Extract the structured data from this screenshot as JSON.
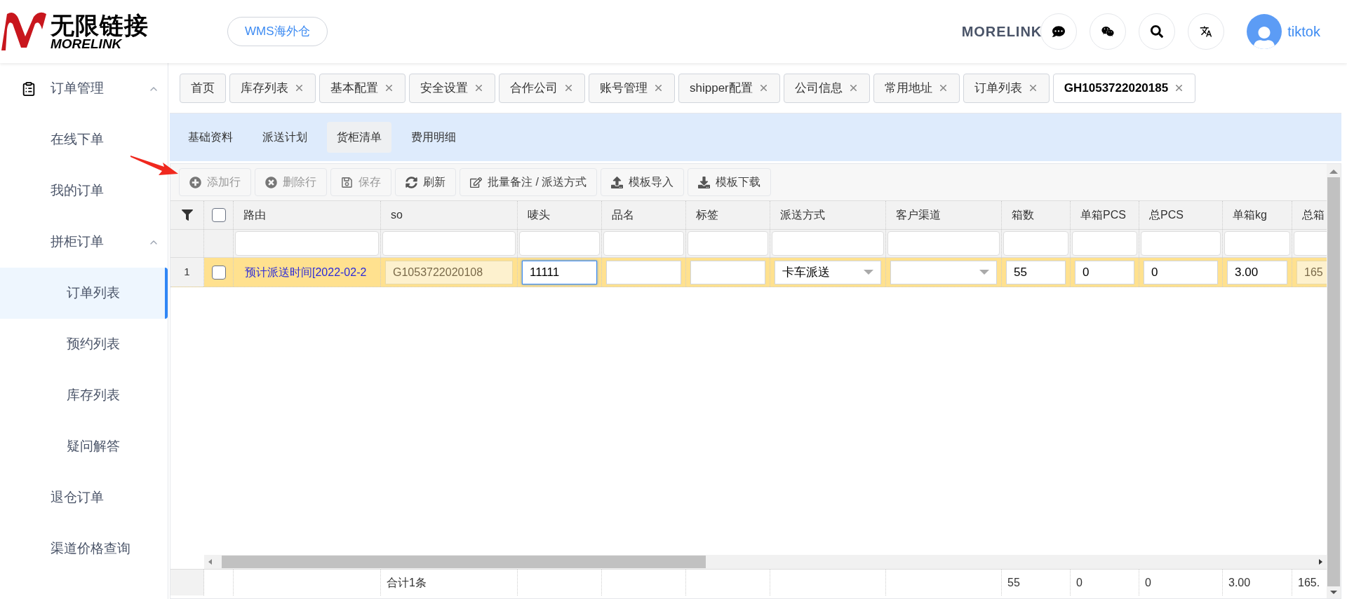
{
  "header": {
    "logo_title": "无限链接",
    "logo_subtitle": "MORELINK",
    "warehouse_button": "WMS海外仓",
    "brand": "MORELINK",
    "user": "tiktok"
  },
  "sidebar": {
    "items": [
      {
        "label": "订单管理",
        "expanded": true,
        "children": [
          {
            "label": "在线下单",
            "selected": false
          },
          {
            "label": "我的订单",
            "selected": false
          },
          {
            "label": "拼柜订单",
            "expanded": true,
            "selected": false,
            "children": [
              {
                "label": "订单列表",
                "selected": true
              },
              {
                "label": "预约列表",
                "selected": false
              },
              {
                "label": "库存列表",
                "selected": false
              },
              {
                "label": "疑问解答",
                "selected": false
              }
            ]
          },
          {
            "label": "退仓订单",
            "selected": false
          },
          {
            "label": "渠道价格查询",
            "selected": false
          }
        ]
      }
    ]
  },
  "tabs": [
    {
      "label": "首页",
      "selected": false,
      "closable": false
    },
    {
      "label": "库存列表",
      "selected": false,
      "closable": true
    },
    {
      "label": "基本配置",
      "selected": false,
      "closable": true
    },
    {
      "label": "安全设置",
      "selected": false,
      "closable": true
    },
    {
      "label": "合作公司",
      "selected": false,
      "closable": true
    },
    {
      "label": "账号管理",
      "selected": false,
      "closable": true
    },
    {
      "label": "shipper配置",
      "selected": false,
      "closable": true
    },
    {
      "label": "公司信息",
      "selected": false,
      "closable": true
    },
    {
      "label": "常用地址",
      "selected": false,
      "closable": true
    },
    {
      "label": "订单列表",
      "selected": false,
      "closable": true
    },
    {
      "label": "GH1053722020185",
      "selected": true,
      "closable": true
    }
  ],
  "subtabs": [
    {
      "label": "基础资料",
      "selected": false
    },
    {
      "label": "派送计划",
      "selected": false
    },
    {
      "label": "货柜清单",
      "selected": true
    },
    {
      "label": "费用明细",
      "selected": false
    }
  ],
  "toolbar": [
    {
      "label": "添加行",
      "disabled": true
    },
    {
      "label": "删除行",
      "disabled": true
    },
    {
      "label": "保存",
      "disabled": true
    },
    {
      "label": "刷新",
      "disabled": false
    },
    {
      "label": "批量备注 / 派送方式",
      "disabled": false
    },
    {
      "label": "模板导入",
      "disabled": false
    },
    {
      "label": "模板下载",
      "disabled": false
    }
  ],
  "table": {
    "all_checked": false,
    "columns": [
      {
        "label": "路由"
      },
      {
        "label": "so"
      },
      {
        "label": "唛头"
      },
      {
        "label": "品名"
      },
      {
        "label": "标签"
      },
      {
        "label": "派送方式"
      },
      {
        "label": "客户渠道"
      },
      {
        "label": "箱数"
      },
      {
        "label": "单箱PCS"
      },
      {
        "label": "总PCS"
      },
      {
        "label": "单箱kg"
      },
      {
        "label": "总箱"
      }
    ],
    "rows": [
      {
        "number": "1",
        "checked": false,
        "selected": true,
        "cells": [
          {
            "kind": "link",
            "value": "预计派送时间[2022-02-2"
          },
          {
            "kind": "readonly",
            "value": "G1053722020108"
          },
          {
            "kind": "input",
            "value": "11111",
            "focused": true
          },
          {
            "kind": "input",
            "focused": false
          },
          {
            "kind": "input",
            "focused": false
          },
          {
            "kind": "select",
            "value": "卡车派送"
          },
          {
            "kind": "select"
          },
          {
            "kind": "input",
            "value": "55",
            "focused": false
          },
          {
            "kind": "input",
            "value": "0",
            "focused": false
          },
          {
            "kind": "input",
            "value": "0",
            "focused": false
          },
          {
            "kind": "input",
            "value": "3.00",
            "focused": false
          },
          {
            "kind": "readonly",
            "value": "165"
          }
        ]
      }
    ],
    "footer": {
      "cells": [
        {},
        {
          "value": "合计1条"
        },
        {},
        {},
        {},
        {},
        {},
        {
          "value": "55"
        },
        {
          "value": "0"
        },
        {
          "value": "0"
        },
        {
          "value": "3.00"
        },
        {
          "value": "165."
        }
      ]
    }
  }
}
